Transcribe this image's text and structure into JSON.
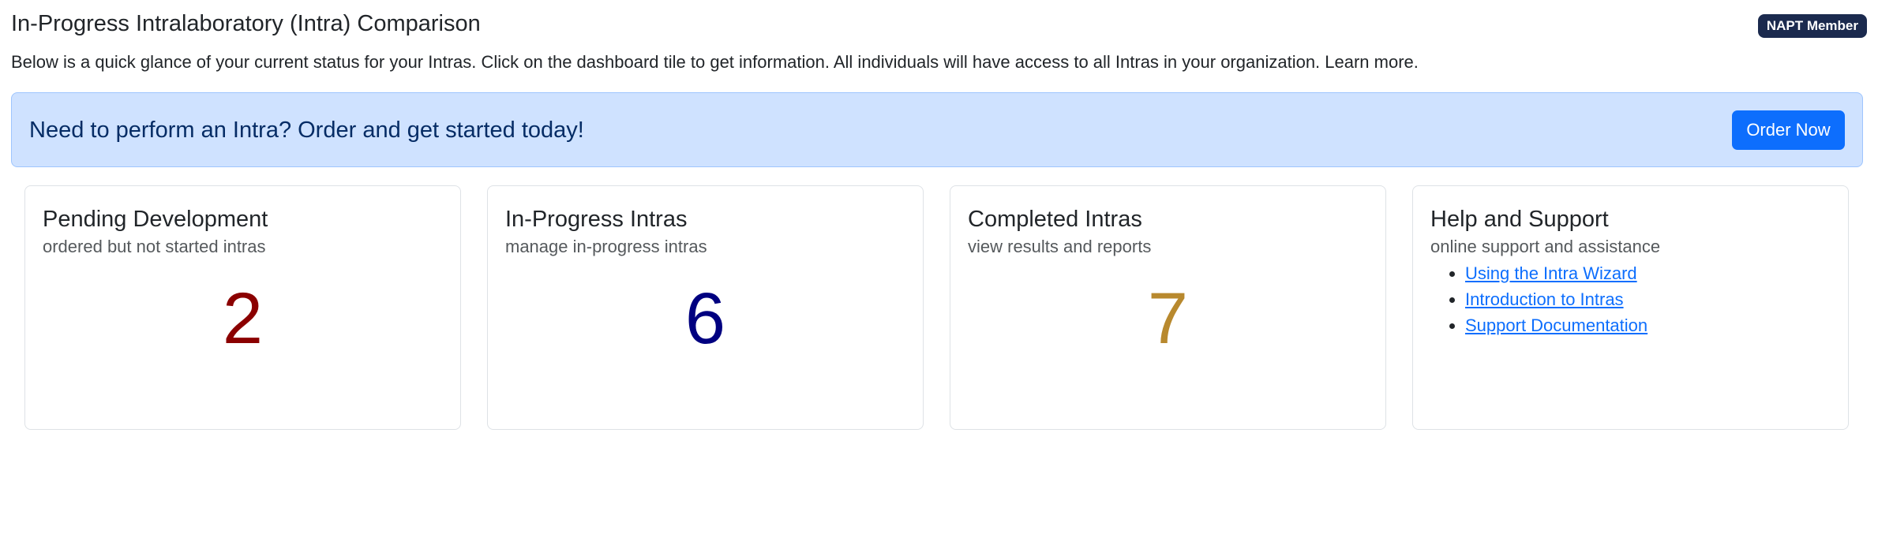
{
  "header": {
    "title": "In-Progress Intralaboratory (Intra) Comparison",
    "badge": "NAPT Member",
    "intro": "Below is a quick glance of your current status for your Intras. Click on the dashboard tile to get information. All individuals will have access to all Intras in your organization. Learn more."
  },
  "banner": {
    "text": "Need to perform an Intra? Order and get started today!",
    "button_label": "Order Now"
  },
  "cards": [
    {
      "title": "Pending Development",
      "subtitle": "ordered but not started intras",
      "count": "2",
      "count_color": "#8b0000"
    },
    {
      "title": "In-Progress Intras",
      "subtitle": "manage in-progress intras",
      "count": "6",
      "count_color": "#000080"
    },
    {
      "title": "Completed Intras",
      "subtitle": "view results and reports",
      "count": "7",
      "count_color": "#b8892e"
    },
    {
      "title": "Help and Support",
      "subtitle": "online support and assistance",
      "links": [
        "Using the Intra Wizard",
        "Introduction to Intras",
        "Support Documentation"
      ]
    }
  ],
  "colors": {
    "banner_bg": "#cfe2ff",
    "accent": "#0d6efd",
    "badge_bg": "#1b2a4e"
  }
}
